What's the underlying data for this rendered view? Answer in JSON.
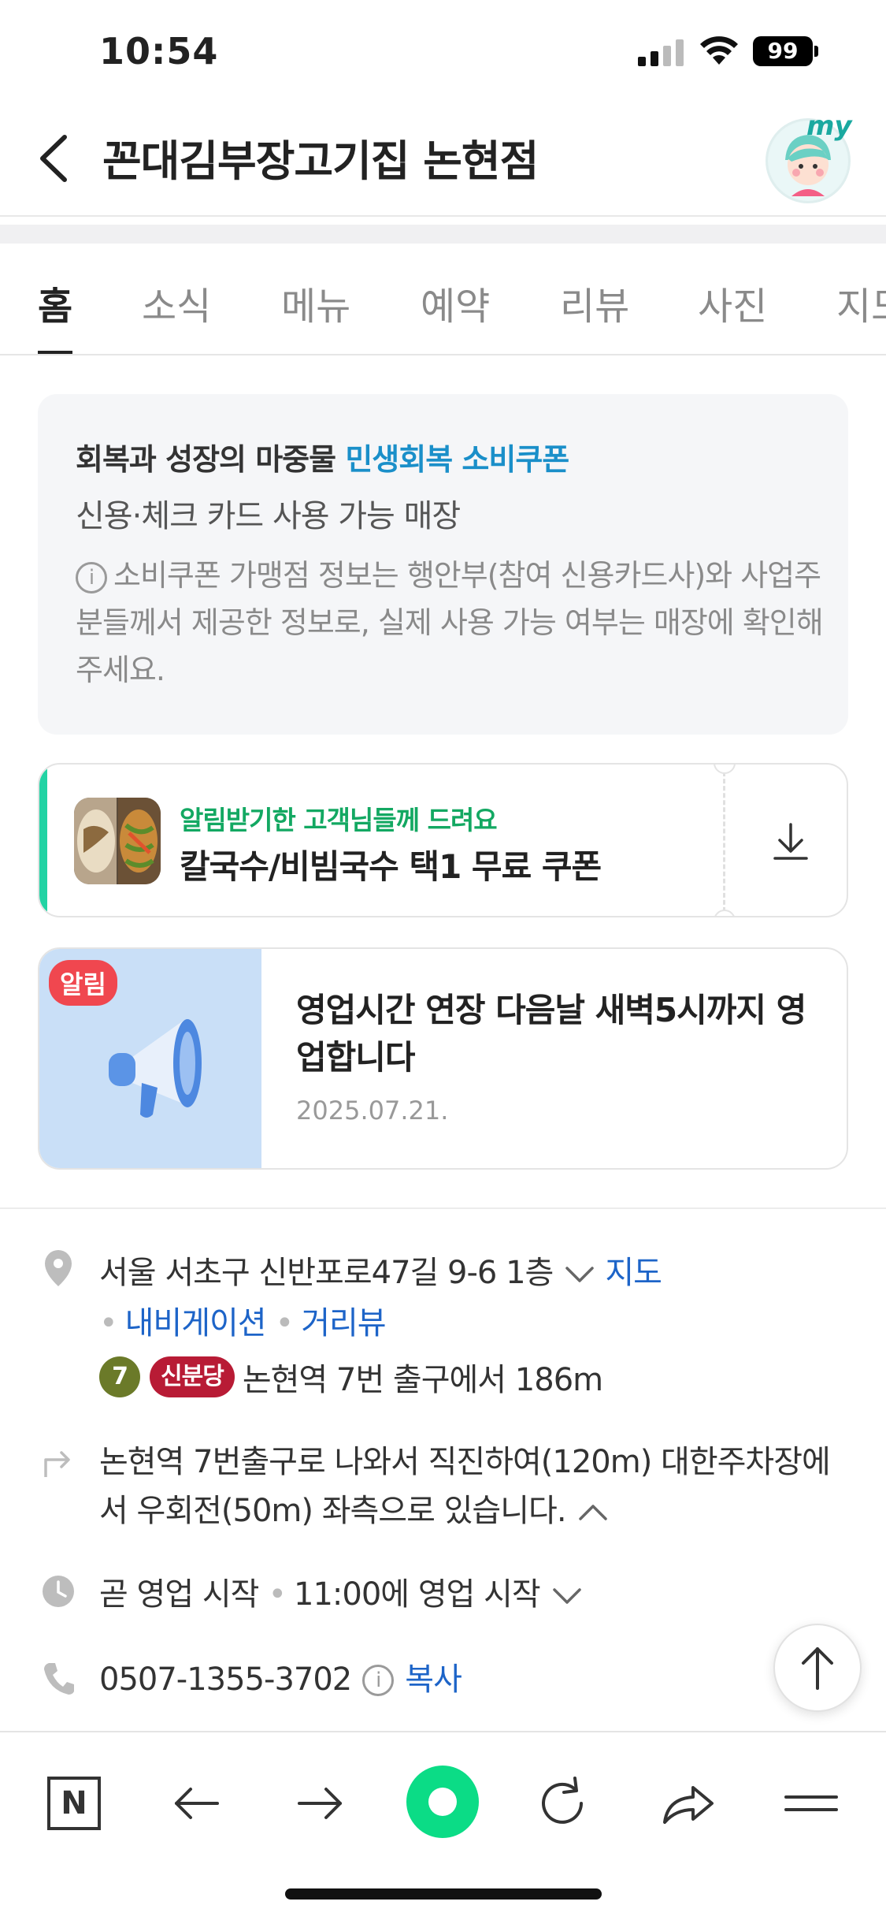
{
  "status_bar": {
    "time": "10:54",
    "battery": "99"
  },
  "header": {
    "title": "꼰대김부장고기집 논현점",
    "my_label": "my"
  },
  "tabs": [
    "홈",
    "소식",
    "메뉴",
    "예약",
    "리뷰",
    "사진",
    "지도"
  ],
  "coupon_info": {
    "prefix": "회복과 성장의 마중물 ",
    "highlight": "민생회복 소비쿠폰",
    "subtitle": "신용·체크 카드 사용 가능 매장",
    "note": "소비쿠폰 가맹점 정보는 행안부(참여 신용카드사)와 사업주분들께서 제공한 정보로, 실제 사용 가능 여부는 매장에 확인해 주세요.",
    "info_glyph": "i"
  },
  "coupon": {
    "subtitle": "알림받기한 고객님들께 드려요",
    "title": "칼국수/비빔국수 택1 무료 쿠폰"
  },
  "notice": {
    "badge": "알림",
    "title": "영업시간 연장 다음날 새벽5시까지 영업합니다",
    "date": "2025.07.21."
  },
  "address": {
    "text": "서울 서초구 신반포로47길 9-6 1층",
    "map_link": "지도",
    "nav_link": "내비게이션",
    "street_link": "거리뷰"
  },
  "subway": {
    "line_number": "7",
    "line_name": "신분당",
    "text": "논현역 7번 출구에서 186m"
  },
  "directions": "논현역 7번출구로 나와서 직진하여(120m) 대한주차장에서 우회전(50m) 좌측으로 있습니다.",
  "hours": {
    "status": "곧 영업 시작",
    "detail": "11:00에 영업 시작"
  },
  "phone": {
    "number": "0507-1355-3702",
    "copy_label": "복사",
    "info_glyph": "i"
  },
  "bottom_nav": {
    "home_letter": "N"
  },
  "colors": {
    "accent_blue": "#1d64c8",
    "coupon_green": "#13a862",
    "badge_red": "#f0474f",
    "naver_green": "#03c75a"
  }
}
